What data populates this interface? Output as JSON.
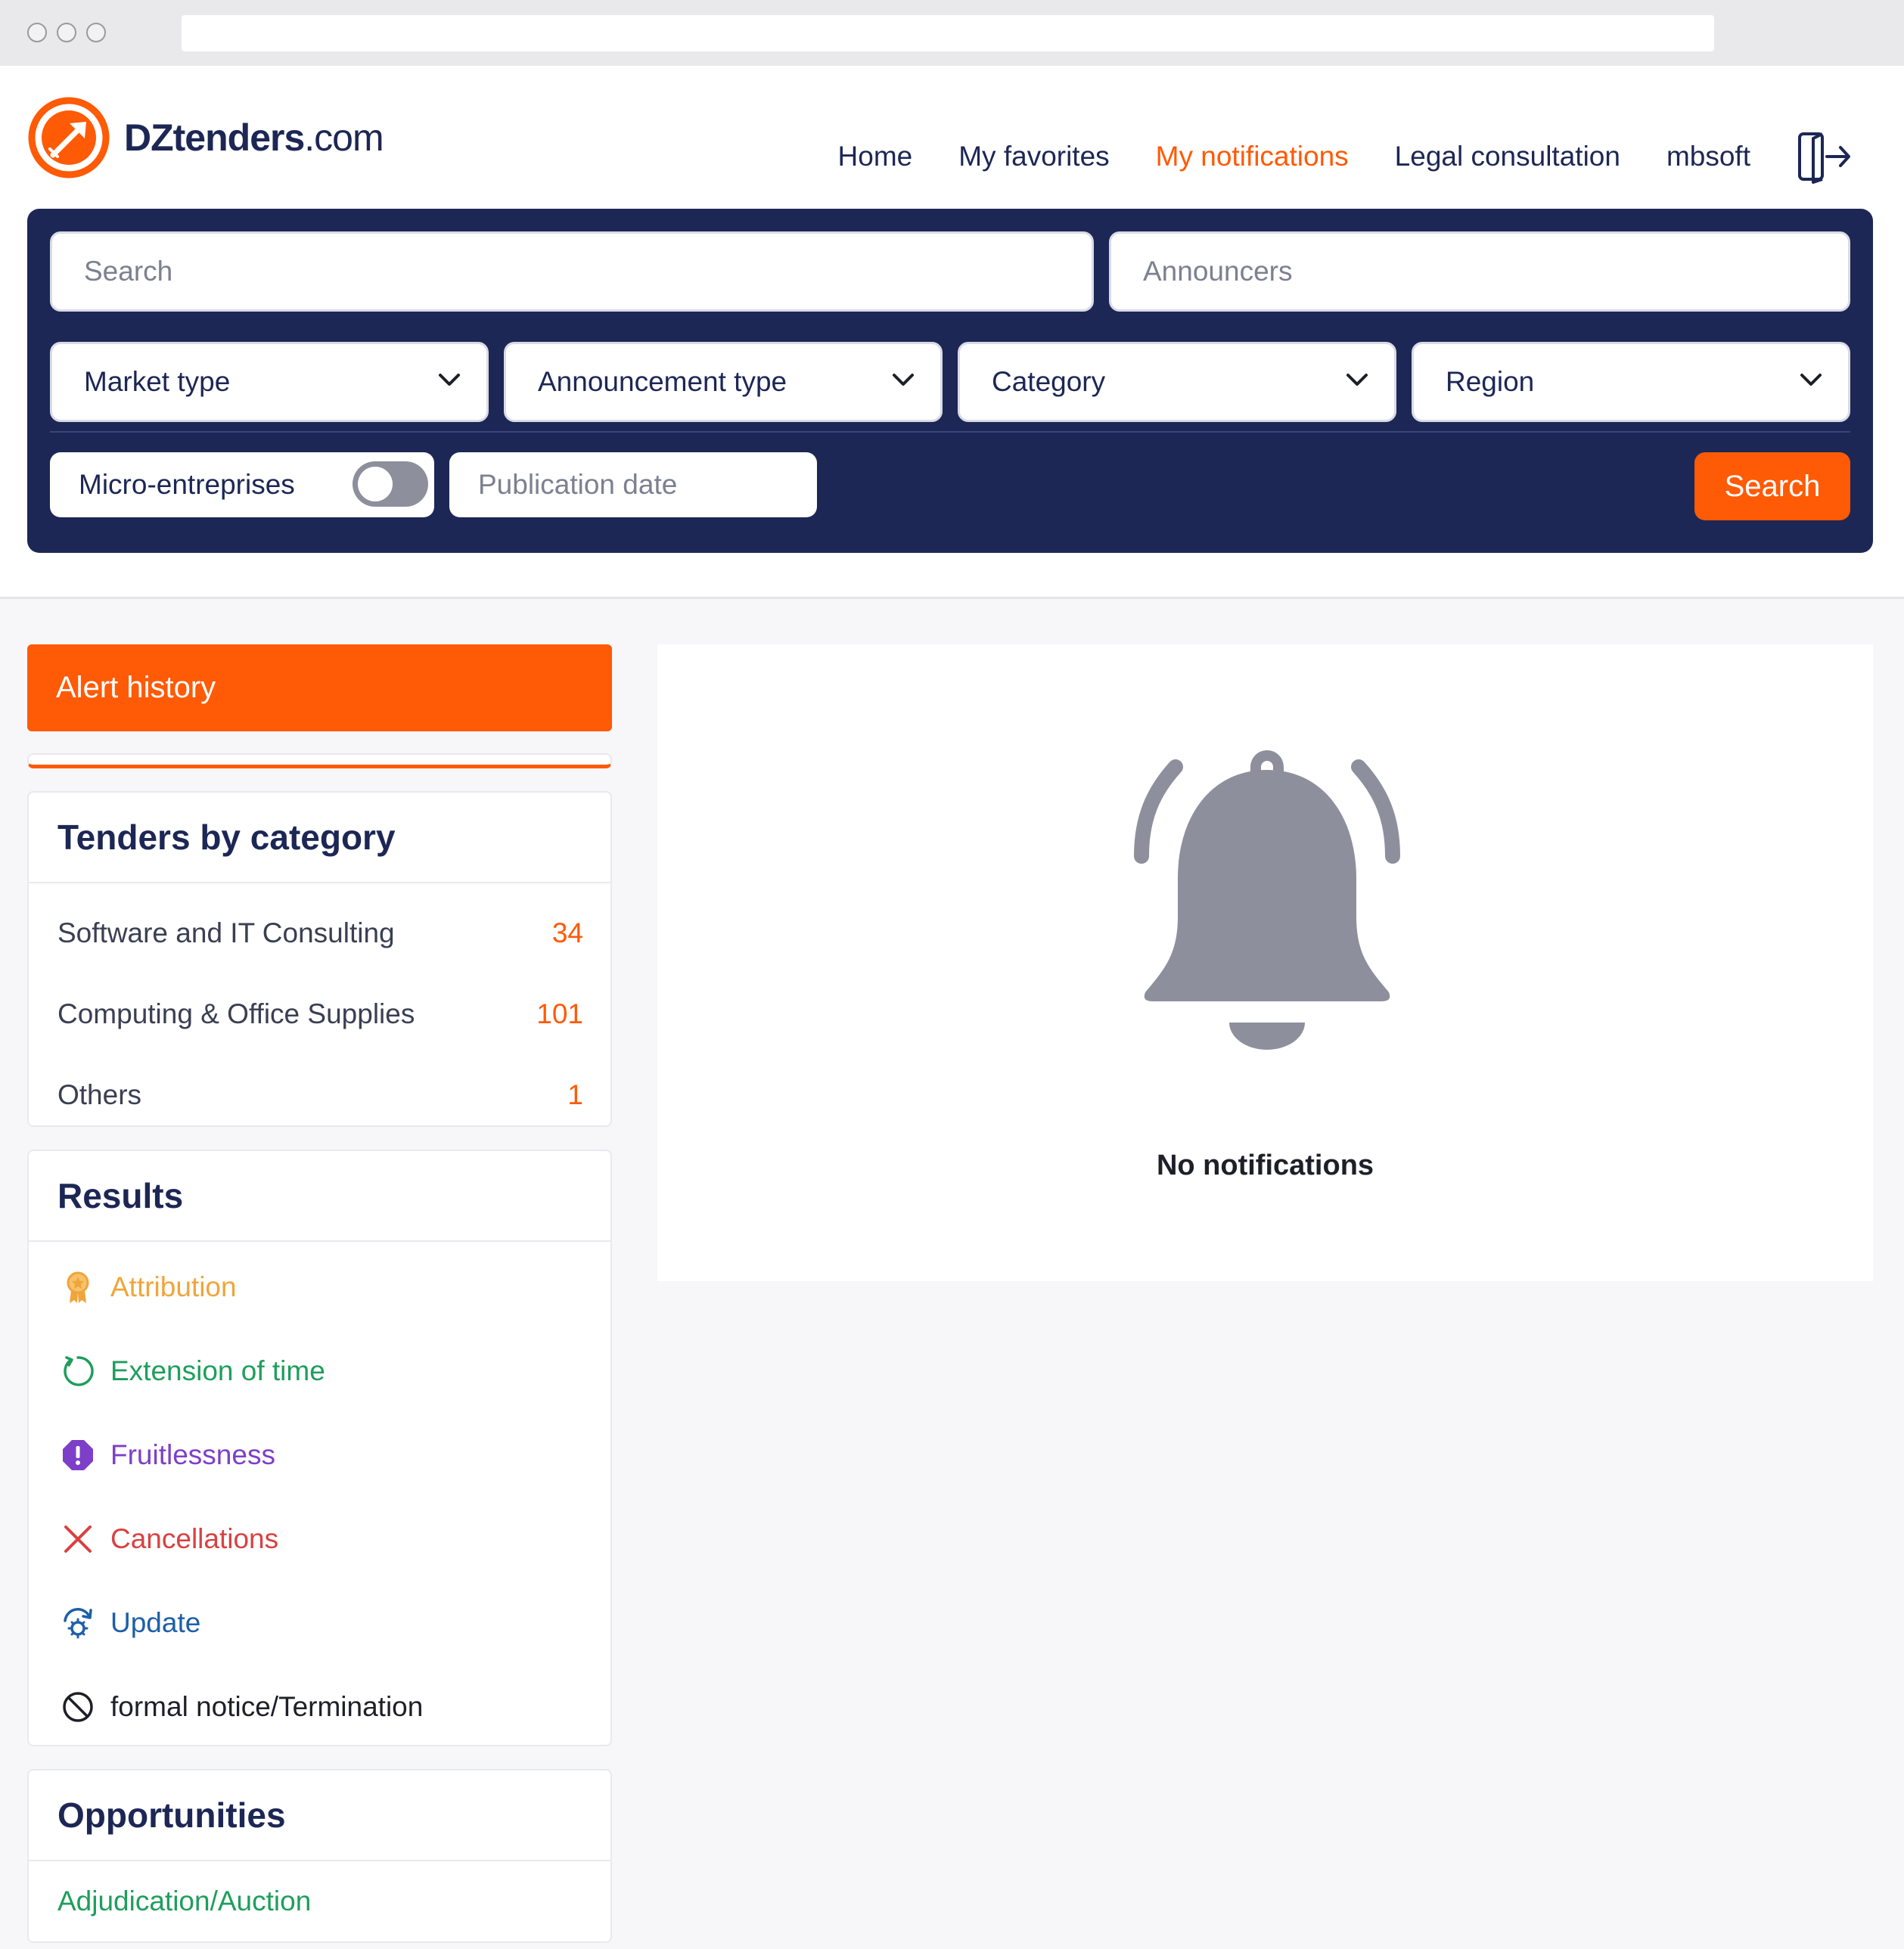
{
  "brand": {
    "name_bold": "DZtenders",
    "name_suffix": ".com",
    "primary_color": "#ff5a05",
    "navy_color": "#1d2755"
  },
  "nav": {
    "home": "Home",
    "favorites": "My favorites",
    "notifications": "My notifications",
    "legal": "Legal consultation",
    "user": "mbsoft",
    "active": "My notifications"
  },
  "search": {
    "keyword_placeholder": "Search",
    "announcers_placeholder": "Announcers",
    "market_type": "Market type",
    "announcement_type": "Announcement type",
    "category": "Category",
    "region": "Region",
    "micro_label": "Micro-entreprises",
    "micro_enabled": false,
    "publication_date_placeholder": "Publication date",
    "button": "Search"
  },
  "sidebar": {
    "alert_history": "Alert history",
    "categories": {
      "title": "Tenders by category",
      "items": [
        {
          "label": "Software and IT Consulting",
          "count": "34"
        },
        {
          "label": "Computing & Office Supplies",
          "count": "101"
        },
        {
          "label": "Others",
          "count": "1"
        }
      ]
    },
    "results": {
      "title": "Results",
      "items": [
        {
          "label": "Attribution",
          "icon": "award-icon",
          "color": "#f0a53a"
        },
        {
          "label": "Extension of time",
          "icon": "refresh-icon",
          "color": "#1e9e5c"
        },
        {
          "label": "Fruitlessness",
          "icon": "alert-octagon-icon",
          "color": "#7d3fc8"
        },
        {
          "label": "Cancellations",
          "icon": "close-icon",
          "color": "#d94141"
        },
        {
          "label": "Update",
          "icon": "update-icon",
          "color": "#1d5fa8"
        },
        {
          "label": "formal notice/Termination",
          "icon": "ban-icon",
          "color": "#1e1f28"
        }
      ]
    },
    "opportunities": {
      "title": "Opportunities",
      "items": [
        {
          "label": "Adjudication/Auction",
          "color": "#1e9e5c"
        }
      ]
    }
  },
  "main": {
    "empty_icon": "bell-icon",
    "empty_text": "No notifications"
  }
}
